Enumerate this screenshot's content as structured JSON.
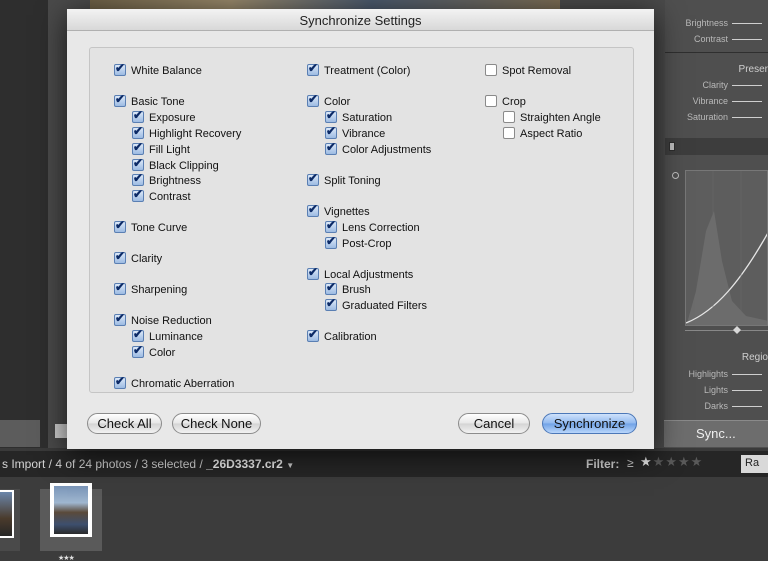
{
  "dialog": {
    "title": "Synchronize Settings",
    "columns": [
      [
        {
          "label": "White Balance",
          "checked": true,
          "indent": 0
        },
        {
          "label": "Basic Tone",
          "checked": true,
          "indent": 0
        },
        {
          "label": "Exposure",
          "checked": true,
          "indent": 1
        },
        {
          "label": "Highlight Recovery",
          "checked": true,
          "indent": 1
        },
        {
          "label": "Fill Light",
          "checked": true,
          "indent": 1
        },
        {
          "label": "Black Clipping",
          "checked": true,
          "indent": 1
        },
        {
          "label": "Brightness",
          "checked": true,
          "indent": 1
        },
        {
          "label": "Contrast",
          "checked": true,
          "indent": 1
        },
        {
          "label": "Tone Curve",
          "checked": true,
          "indent": 0
        },
        {
          "label": "Clarity",
          "checked": true,
          "indent": 0
        },
        {
          "label": "Sharpening",
          "checked": true,
          "indent": 0
        },
        {
          "label": "Noise Reduction",
          "checked": true,
          "indent": 0
        },
        {
          "label": "Luminance",
          "checked": true,
          "indent": 1
        },
        {
          "label": "Color",
          "checked": true,
          "indent": 1
        },
        {
          "label": "Chromatic Aberration",
          "checked": true,
          "indent": 0
        }
      ],
      [
        {
          "label": "Treatment (Color)",
          "checked": true,
          "indent": 0
        },
        {
          "label": "Color",
          "checked": true,
          "indent": 0
        },
        {
          "label": "Saturation",
          "checked": true,
          "indent": 1
        },
        {
          "label": "Vibrance",
          "checked": true,
          "indent": 1
        },
        {
          "label": "Color Adjustments",
          "checked": true,
          "indent": 1
        },
        {
          "label": "Split Toning",
          "checked": true,
          "indent": 0
        },
        {
          "label": "Vignettes",
          "checked": true,
          "indent": 0
        },
        {
          "label": "Lens Correction",
          "checked": true,
          "indent": 1
        },
        {
          "label": "Post-Crop",
          "checked": true,
          "indent": 1
        },
        {
          "label": "Local Adjustments",
          "checked": true,
          "indent": 0
        },
        {
          "label": "Brush",
          "checked": true,
          "indent": 1
        },
        {
          "label": "Graduated Filters",
          "checked": true,
          "indent": 1
        },
        {
          "label": "Calibration",
          "checked": true,
          "indent": 0
        }
      ],
      [
        {
          "label": "Spot Removal",
          "checked": false,
          "indent": 0
        },
        {
          "label": "Crop",
          "checked": false,
          "indent": 0
        },
        {
          "label": "Straighten Angle",
          "checked": false,
          "indent": 1
        },
        {
          "label": "Aspect Ratio",
          "checked": false,
          "indent": 1
        }
      ]
    ],
    "buttons": {
      "check_all": "Check All",
      "check_none": "Check None",
      "cancel": "Cancel",
      "synchronize": "Synchronize"
    }
  },
  "right_panel": {
    "brightness": "Brightness",
    "contrast": "Contrast",
    "presence_header": "Preser",
    "clarity": "Clarity",
    "vibrance": "Vibrance",
    "saturation": "Saturation",
    "region_header": "Regio",
    "highlights": "Highlights",
    "lights": "Lights",
    "darks": "Darks",
    "sync_button": "Sync..."
  },
  "filmstrip": {
    "path_prefix": "s Import / 4 of 24 photos / 3 selected / ",
    "filename": "_26D3337.cr2",
    "filter_label": "Filter:",
    "filter_op": "≥",
    "filter_stars_on": 1,
    "filter_stars_total": 5,
    "rating_chip": "Ra",
    "thumb_rating": "★★★"
  },
  "colors": {
    "checkbox_checked": "#9dbbe2",
    "primary_button": "#6fa1e6"
  }
}
